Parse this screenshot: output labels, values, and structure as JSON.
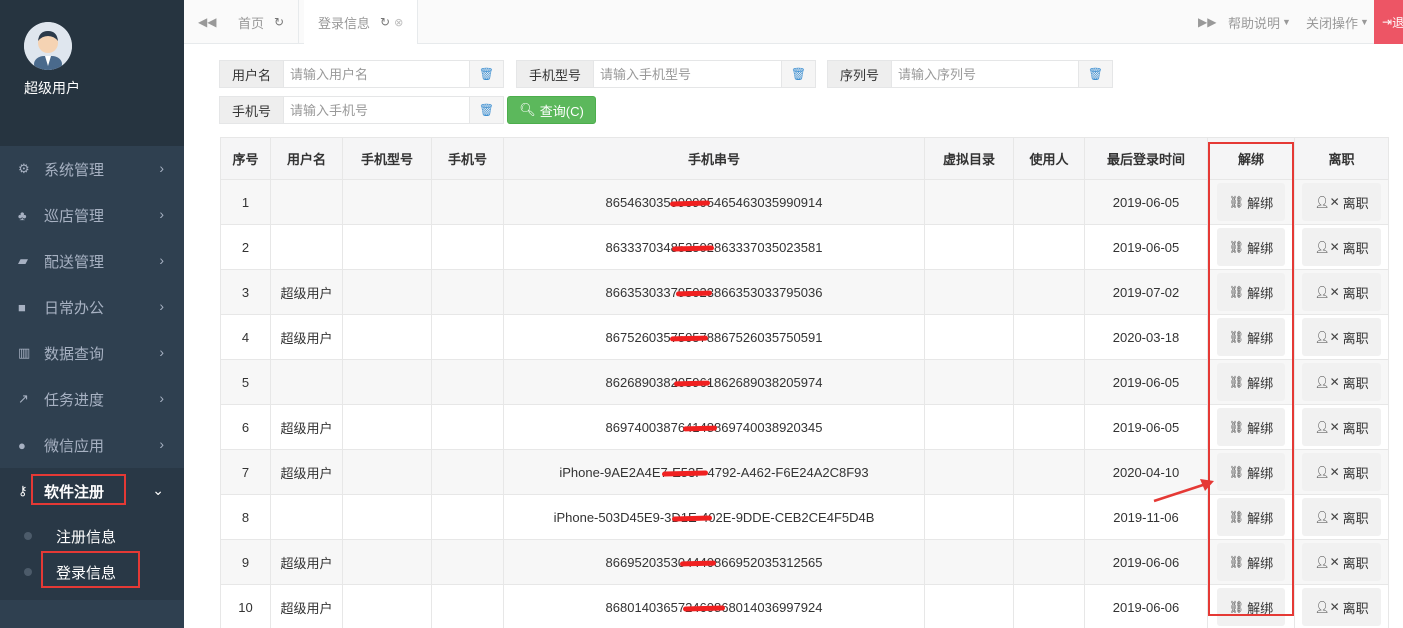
{
  "sidebar": {
    "user_name": "超级用户",
    "items": [
      {
        "icon": "gears-icon",
        "glyph": "⚙",
        "label": "系统管理"
      },
      {
        "icon": "sitemap-icon",
        "glyph": "♣",
        "label": "巡店管理"
      },
      {
        "icon": "truck-icon",
        "glyph": "▰",
        "label": "配送管理"
      },
      {
        "icon": "briefcase-icon",
        "glyph": "■",
        "label": "日常办公"
      },
      {
        "icon": "bar-chart-icon",
        "glyph": "▥",
        "label": "数据查询"
      },
      {
        "icon": "line-chart-icon",
        "glyph": "↗",
        "label": "任务进度"
      },
      {
        "icon": "wechat-icon",
        "glyph": "●",
        "label": "微信应用"
      },
      {
        "icon": "key-icon",
        "glyph": "⚷",
        "label": "软件注册"
      }
    ],
    "sub_items": [
      "注册信息",
      "登录信息"
    ]
  },
  "tabbar": {
    "tabs": [
      "首页",
      "登录信息"
    ],
    "help_label": "帮助说明",
    "close_ops_label": "关闭操作",
    "logout_label": "退出"
  },
  "search": {
    "fields": [
      {
        "label": "用户名",
        "placeholder": "请输入用户名"
      },
      {
        "label": "手机型号",
        "placeholder": "请输入手机型号"
      },
      {
        "label": "序列号",
        "placeholder": "请输入序列号"
      },
      {
        "label": "手机号",
        "placeholder": "请输入手机号"
      }
    ],
    "query_label": "查询(C)"
  },
  "table": {
    "headers": [
      "序号",
      "用户名",
      "手机型号",
      "手机号",
      "手机串号",
      "虚拟目录",
      "使用人",
      "最后登录时间",
      "解绑",
      "离职"
    ],
    "unbind_label": "解绑",
    "resign_label": "离职",
    "rows": [
      {
        "no": "1",
        "user": "",
        "model": "",
        "phone": "",
        "imei": "865463035990905465463035990914",
        "vdir": "",
        "holder": "",
        "last_login": "2019-06-05"
      },
      {
        "no": "2",
        "user": "",
        "model": "",
        "phone": "",
        "imei": "863337034852502863337035023581",
        "vdir": "",
        "holder": "",
        "last_login": "2019-06-05"
      },
      {
        "no": "3",
        "user": "超级用户",
        "model": "",
        "phone": "",
        "imei": "866353033795023866353033795036",
        "vdir": "",
        "holder": "",
        "last_login": "2019-07-02"
      },
      {
        "no": "4",
        "user": "超级用户",
        "model": "",
        "phone": "",
        "imei": "867526035750578867526035750591",
        "vdir": "",
        "holder": "",
        "last_login": "2020-03-18"
      },
      {
        "no": "5",
        "user": "",
        "model": "",
        "phone": "",
        "imei": "862689038205961862689038205974",
        "vdir": "",
        "holder": "",
        "last_login": "2019-06-05"
      },
      {
        "no": "6",
        "user": "超级用户",
        "model": "",
        "phone": "",
        "imei": "869740038764148869740038920345",
        "vdir": "",
        "holder": "",
        "last_login": "2019-06-05"
      },
      {
        "no": "7",
        "user": "超级用户",
        "model": "",
        "phone": "",
        "imei": "iPhone-9AE2A4E7-E53F-4792-A462-F6E24A2C8F93",
        "vdir": "",
        "holder": "",
        "last_login": "2020-04-10"
      },
      {
        "no": "8",
        "user": "",
        "model": "",
        "phone": "",
        "imei": "iPhone-503D45E9-3D1E-402E-9DDE-CEB2CE4F5D4B",
        "vdir": "",
        "holder": "",
        "last_login": "2019-11-06"
      },
      {
        "no": "9",
        "user": "超级用户",
        "model": "",
        "phone": "",
        "imei": "866952035304440866952035312565",
        "vdir": "",
        "holder": "",
        "last_login": "2019-06-06"
      },
      {
        "no": "10",
        "user": "超级用户",
        "model": "",
        "phone": "",
        "imei": "868014036572460868014036997924",
        "vdir": "",
        "holder": "",
        "last_login": "2019-06-06"
      }
    ]
  },
  "colors": {
    "sidebar_bg": "#2f4050",
    "accent_green": "#5cb85c",
    "highlight_red": "#e53935",
    "logout_red": "#ed5565"
  }
}
